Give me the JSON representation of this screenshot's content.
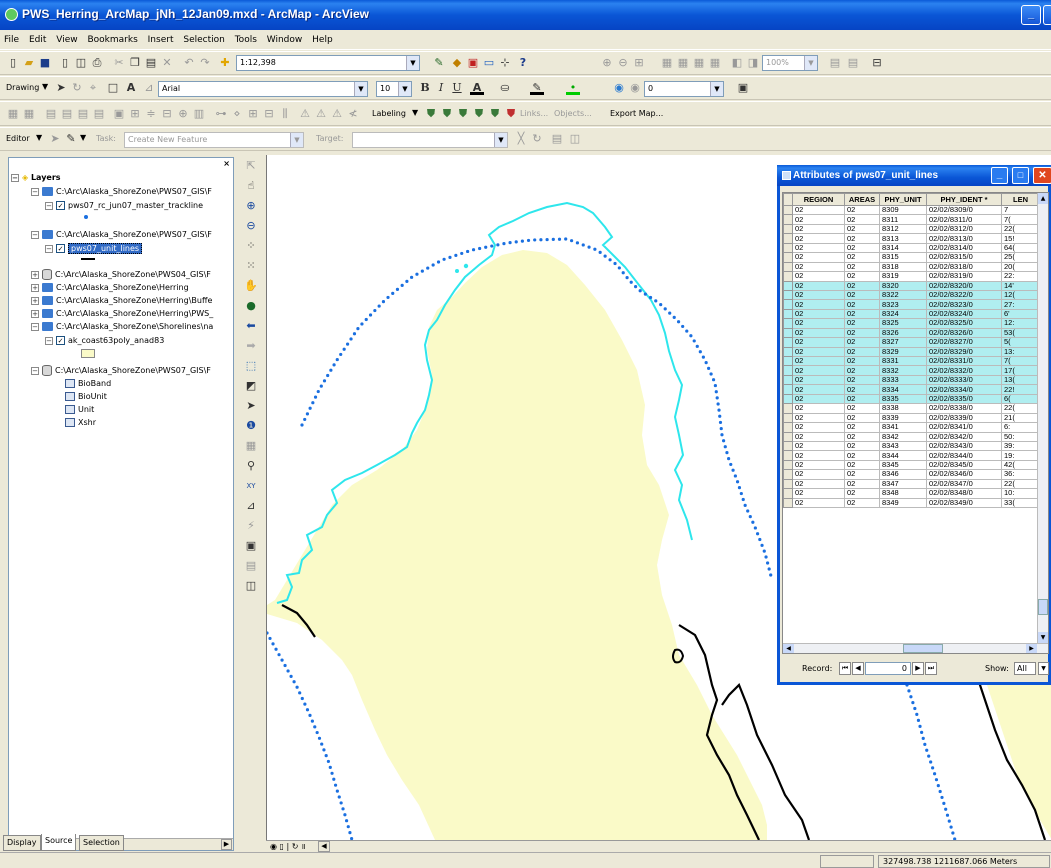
{
  "window": {
    "title": "PWS_Herring_ArcMap_jNh_12Jan09.mxd - ArcMap - ArcView"
  },
  "menu": [
    "File",
    "Edit",
    "View",
    "Bookmarks",
    "Insert",
    "Selection",
    "Tools",
    "Window",
    "Help"
  ],
  "standard_toolbar": {
    "scale": "1:12,398"
  },
  "drawing_toolbar": {
    "drawing_label": "Drawing",
    "font": "Arial",
    "font_size": "10",
    "spin_value": "0"
  },
  "labeling_toolbar": {
    "labeling": "Labeling",
    "links": "Links...",
    "objects": "Objects...",
    "export_map": "Export Map..."
  },
  "editor_toolbar": {
    "editor": "Editor",
    "task_label": "Task:",
    "task_value": "Create New Feature",
    "target_label": "Target:"
  },
  "toc": {
    "root": "Layers",
    "items": [
      {
        "text": "C:\\Arc\\Alaska_ShoreZone\\PWS07_GIS\\F"
      },
      {
        "text": "pws07_rc_jun07_master_trackline"
      },
      {
        "text": "C:\\Arc\\Alaska_ShoreZone\\PWS07_GIS\\F"
      },
      {
        "text": "pws07_unit_lines"
      },
      {
        "text": "C:\\Arc\\Alaska_ShoreZone\\PWS04_GIS\\F"
      },
      {
        "text": "C:\\Arc\\Alaska_ShoreZone\\Herring"
      },
      {
        "text": "C:\\Arc\\Alaska_ShoreZone\\Herring\\Buffe"
      },
      {
        "text": "C:\\Arc\\Alaska_ShoreZone\\Herring\\PWS_"
      },
      {
        "text": "C:\\Arc\\Alaska_ShoreZone\\Shorelines\\na"
      },
      {
        "text": "ak_coast63poly_anad83"
      },
      {
        "text": "C:\\Arc\\Alaska_ShoreZone\\PWS07_GIS\\F"
      },
      {
        "text": "BioBand"
      },
      {
        "text": "BioUnit"
      },
      {
        "text": "Unit"
      },
      {
        "text": "Xshr"
      }
    ],
    "tabs": [
      "Display",
      "Source",
      "Selection"
    ]
  },
  "attributes": {
    "title": "Attributes of pws07_unit_lines",
    "columns": [
      "REGION",
      "AREAS",
      "PHY_UNIT",
      "PHY_IDENT *",
      "LEN"
    ],
    "rows": [
      [
        "02",
        "02",
        "8309",
        "02/02/8309/0",
        "7"
      ],
      [
        "02",
        "02",
        "8311",
        "02/02/8311/0",
        "7("
      ],
      [
        "02",
        "02",
        "8312",
        "02/02/8312/0",
        "22("
      ],
      [
        "02",
        "02",
        "8313",
        "02/02/8313/0",
        "15!"
      ],
      [
        "02",
        "02",
        "8314",
        "02/02/8314/0",
        "64("
      ],
      [
        "02",
        "02",
        "8315",
        "02/02/8315/0",
        "25("
      ],
      [
        "02",
        "02",
        "8318",
        "02/02/8318/0",
        "20("
      ],
      [
        "02",
        "02",
        "8319",
        "02/02/8319/0",
        "22:"
      ],
      [
        "02",
        "02",
        "8320",
        "02/02/8320/0",
        "14'"
      ],
      [
        "02",
        "02",
        "8322",
        "02/02/8322/0",
        "12("
      ],
      [
        "02",
        "02",
        "8323",
        "02/02/8323/0",
        "27:"
      ],
      [
        "02",
        "02",
        "8324",
        "02/02/8324/0",
        "6'"
      ],
      [
        "02",
        "02",
        "8325",
        "02/02/8325/0",
        "12:"
      ],
      [
        "02",
        "02",
        "8326",
        "02/02/8326/0",
        "53("
      ],
      [
        "02",
        "02",
        "8327",
        "02/02/8327/0",
        "5("
      ],
      [
        "02",
        "02",
        "8329",
        "02/02/8329/0",
        "13:"
      ],
      [
        "02",
        "02",
        "8331",
        "02/02/8331/0",
        "7("
      ],
      [
        "02",
        "02",
        "8332",
        "02/02/8332/0",
        "17("
      ],
      [
        "02",
        "02",
        "8333",
        "02/02/8333/0",
        "13("
      ],
      [
        "02",
        "02",
        "8334",
        "02/02/8334/0",
        "22!"
      ],
      [
        "02",
        "02",
        "8335",
        "02/02/8335/0",
        "6("
      ],
      [
        "02",
        "02",
        "8338",
        "02/02/8338/0",
        "22("
      ],
      [
        "02",
        "02",
        "8339",
        "02/02/8339/0",
        "21("
      ],
      [
        "02",
        "02",
        "8341",
        "02/02/8341/0",
        "6:"
      ],
      [
        "02",
        "02",
        "8342",
        "02/02/8342/0",
        "50:"
      ],
      [
        "02",
        "02",
        "8343",
        "02/02/8343/0",
        "39:"
      ],
      [
        "02",
        "02",
        "8344",
        "02/02/8344/0",
        "19:"
      ],
      [
        "02",
        "02",
        "8345",
        "02/02/8345/0",
        "42("
      ],
      [
        "02",
        "02",
        "8346",
        "02/02/8346/0",
        "36:"
      ],
      [
        "02",
        "02",
        "8347",
        "02/02/8347/0",
        "22("
      ],
      [
        "02",
        "02",
        "8348",
        "02/02/8348/0",
        "10:"
      ],
      [
        "02",
        "02",
        "8349",
        "02/02/8349/0",
        "33("
      ]
    ],
    "selected_rows": [
      8,
      9,
      10,
      11,
      12,
      13,
      14,
      15,
      16,
      17,
      18,
      19,
      20
    ],
    "record_label": "Record:",
    "record_value": "0",
    "show_label": "Show:",
    "show_value": "All"
  },
  "status": {
    "coords": "327498.738  1211687.066 Meters"
  },
  "colors": {
    "land": "#fafac8",
    "unit_line": "#2ee6ec",
    "trackline": "#1a6fe0",
    "selection_row": "#b0eef0"
  }
}
